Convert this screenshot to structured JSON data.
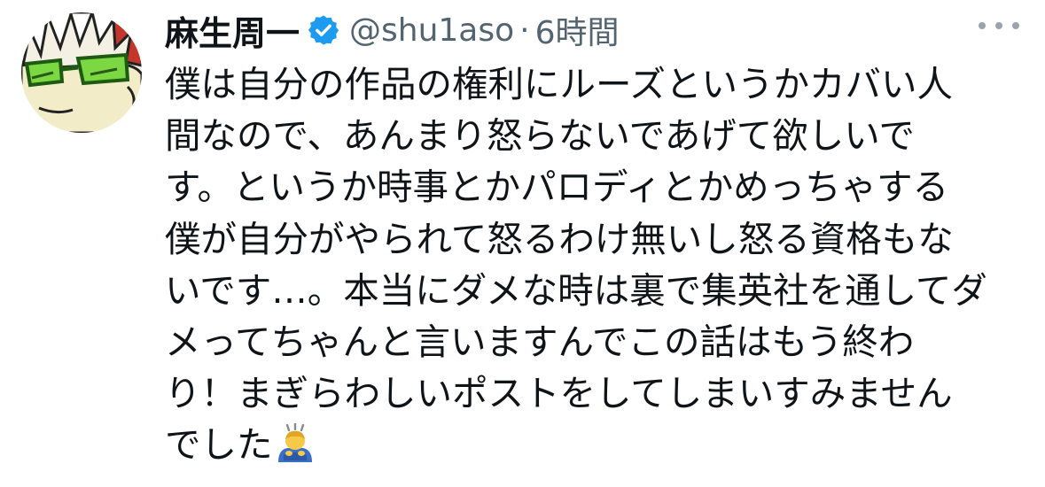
{
  "tweet": {
    "display_name": "麻生周一",
    "handle": "@shu1aso",
    "separator": "·",
    "time": "6時間",
    "text_lines": [
      "僕は自分の作品の権利にルーズというかカバい人",
      "間なので、あんまり怒らないであげて欲しいで",
      "す。というか時事とかパロディとかめっちゃする",
      "僕が自分がやられて怒るわけ無いし怒る資格もな",
      "いです…。本当にダメな時は裏で集英社を通してダ",
      "メってちゃんと言いますんでこの話はもう終わ",
      "り！まぎらわしいポストをしてしまいすみません",
      "でした"
    ],
    "icons": {
      "verified": "verified-badge-icon",
      "more": "more-options-icon",
      "emoji": "person-bowing-emoji-icon",
      "avatar": "avatar-illustration"
    },
    "colors": {
      "text": "#0f1419",
      "secondary": "#536471",
      "verified_blue": "#1d9bf0"
    }
  }
}
